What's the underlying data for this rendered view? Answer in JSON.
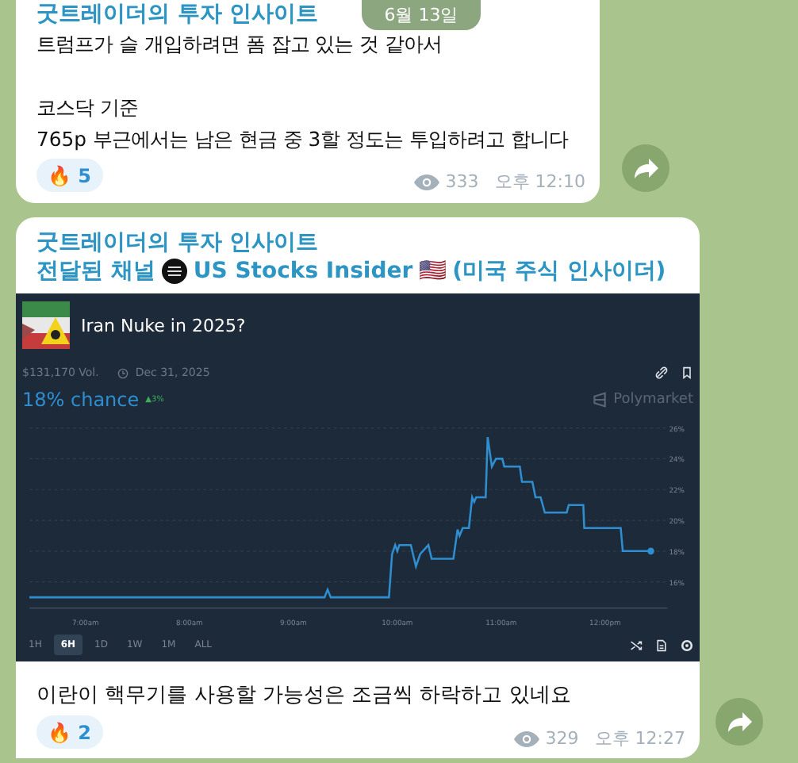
{
  "date_badge": "6월 13일",
  "messages": [
    {
      "channel": "굿트레이더의 투자 인사이트",
      "paragraphs": [
        [
          "트럼프가 슬 개입하려면 폼 잡고 있는 것 같아서"
        ],
        [
          "코스닥 기준",
          "765p 부근에서는 남은 현금 중 3할 정도는 투입하려고 합니다"
        ]
      ],
      "reaction": {
        "emoji": "🔥",
        "count": "5"
      },
      "views": "333",
      "time": "오후 12:10"
    },
    {
      "channel": "굿트레이더의 투자 인사이트",
      "forwarded": {
        "label": "전달된 채널",
        "source": "US Stocks Insider",
        "flag": "🇺🇸",
        "suffix": "(미국 주식 인사이더)"
      },
      "embed": {
        "title": "Iran Nuke in 2025?",
        "volume": "$131,170 Vol.",
        "end_date": "Dec 31, 2025",
        "chance": "18% chance",
        "change": "▲3%",
        "brand": "Polymarket",
        "ranges": [
          {
            "label": "1H",
            "selected": false
          },
          {
            "label": "6H",
            "selected": true
          },
          {
            "label": "1D",
            "selected": false
          },
          {
            "label": "1W",
            "selected": false
          },
          {
            "label": "1M",
            "selected": false
          },
          {
            "label": "ALL",
            "selected": false
          }
        ],
        "chart_data": {
          "type": "line",
          "grid": true,
          "xlim": [
            6.46,
            12.6
          ],
          "ylim": [
            14.3,
            26
          ],
          "xticks": [
            {
              "value": 7,
              "label": "7:00am"
            },
            {
              "value": 8,
              "label": "8:00am"
            },
            {
              "value": 9,
              "label": "9:00am"
            },
            {
              "value": 10,
              "label": "10:00am"
            },
            {
              "value": 11,
              "label": "11:00am"
            },
            {
              "value": 12,
              "label": "12:00pm"
            }
          ],
          "yticks": [
            {
              "value": 16,
              "label": "16%"
            },
            {
              "value": 18,
              "label": "18%"
            },
            {
              "value": 20,
              "label": "20%"
            },
            {
              "value": 22,
              "label": "22%"
            },
            {
              "value": 24,
              "label": "24%"
            },
            {
              "value": 26,
              "label": "26%"
            }
          ],
          "x": [
            6.46,
            9.3,
            9.33,
            9.36,
            9.92,
            9.95,
            9.98,
            10.0,
            10.02,
            10.13,
            10.18,
            10.22,
            10.3,
            10.33,
            10.54,
            10.58,
            10.6,
            10.63,
            10.69,
            10.72,
            10.74,
            10.76,
            10.85,
            10.87,
            10.91,
            10.95,
            11.01,
            11.03,
            11.18,
            11.2,
            11.3,
            11.33,
            11.38,
            11.42,
            11.63,
            11.65,
            11.79,
            11.8,
            12.15,
            12.17,
            12.44
          ],
          "series": [
            {
              "color": "#2e8ed0",
              "values": [
                15,
                15,
                15.5,
                15,
                15,
                17.8,
                18.4,
                18,
                18.4,
                18.4,
                17,
                17.8,
                18.4,
                17.5,
                17.5,
                19.4,
                19,
                19.5,
                19.5,
                21.5,
                21.2,
                21.5,
                21.5,
                25.4,
                23.5,
                24,
                24,
                23.5,
                23.5,
                22.5,
                22.5,
                21.5,
                21.5,
                20.5,
                20.5,
                21,
                21,
                19.5,
                19.5,
                18,
                18
              ]
            }
          ]
        }
      },
      "text": "이란이 핵무기를 사용할 가능성은 조금씩 하락하고 있네요",
      "reaction": {
        "emoji": "🔥",
        "count": "2"
      },
      "views": "329",
      "time": "오후 12:27"
    }
  ]
}
